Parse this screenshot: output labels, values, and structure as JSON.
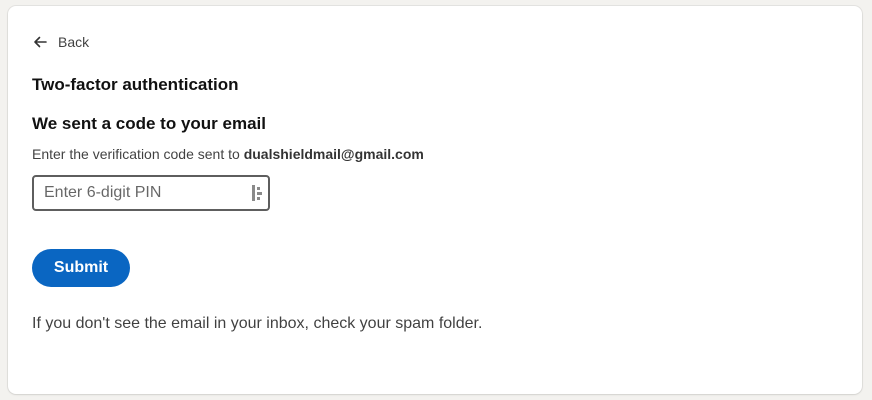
{
  "nav": {
    "back_label": "Back",
    "back_icon": "arrow-left-icon"
  },
  "page": {
    "title": "Two-factor authentication",
    "subtitle": "We sent a code to your email",
    "instruction_prefix": "Enter the verification code sent to",
    "email": "dualshieldmail@gmail.com"
  },
  "form": {
    "pin_placeholder": "Enter 6-digit PIN",
    "pin_value": "",
    "pin_icon": "password-manager-icon",
    "submit_label": "Submit"
  },
  "footer": {
    "spam_note": "If you don't see the email in your inbox, check your spam folder."
  },
  "colors": {
    "accent": "#0a66c2",
    "background": "#f3f2ef",
    "card": "#ffffff"
  }
}
